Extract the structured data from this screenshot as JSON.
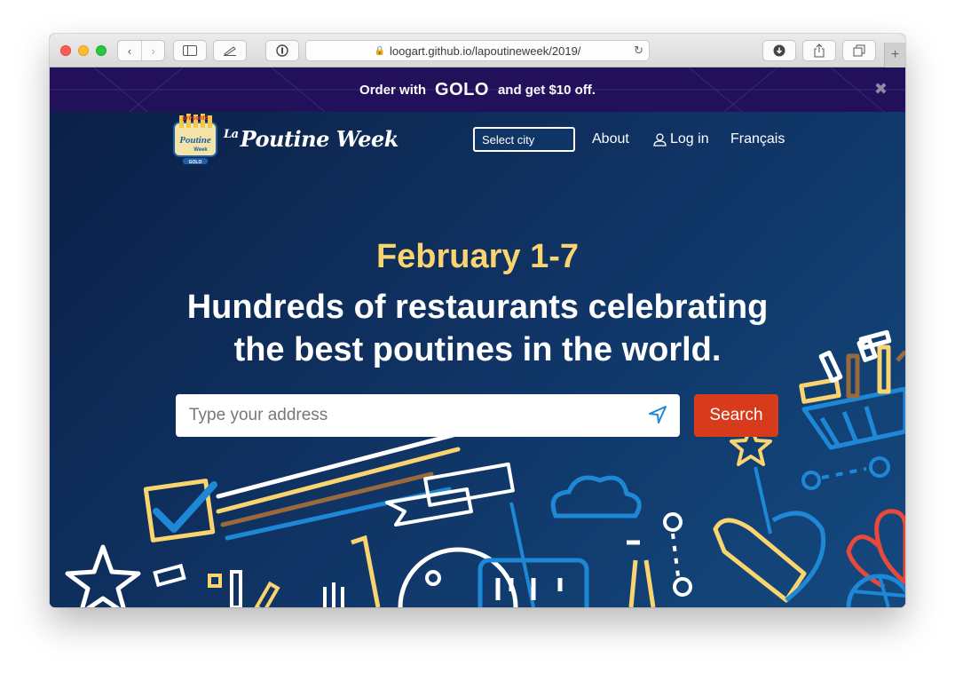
{
  "browser": {
    "url": "loogart.github.io/lapoutineweek/2019/"
  },
  "promo": {
    "text_before": "Order with",
    "brand": "GOLO",
    "text_after": "and get $10 off.",
    "close_icon": "close-icon"
  },
  "logo": {
    "la": "La",
    "name": "Poutine Week",
    "badge_top": "présenté",
    "badge_main": "Poutine",
    "badge_sub": "Week",
    "badge_brand": "GOLO"
  },
  "nav": {
    "select_city": "Select city",
    "about": "About",
    "login": "Log in",
    "language": "Français"
  },
  "hero": {
    "dates": "February 1-7",
    "headline_line1": "Hundreds of restaurants celebrating",
    "headline_line2": "the best poutines in the world."
  },
  "search": {
    "placeholder": "Type your address",
    "button": "Search"
  },
  "colors": {
    "accent_yellow": "#f9d46f",
    "search_red": "#d83a1c",
    "promo_purple": "#22105a",
    "hero_blue": "#103566"
  }
}
